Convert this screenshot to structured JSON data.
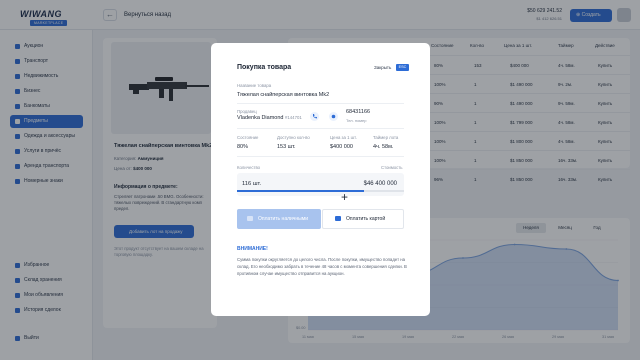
{
  "topbar": {
    "logo_text": "WIWANG",
    "logo_sub": "MARKETPLACE",
    "back_label": "Вернуться назад",
    "balance_main": "$50 629 241.52",
    "balance_sub": "$1 412 626.51",
    "create_label": "Создать"
  },
  "sidebar": {
    "items": [
      {
        "label": "Аукцион"
      },
      {
        "label": "Транспорт"
      },
      {
        "label": "Недвижимость"
      },
      {
        "label": "Бизнес"
      },
      {
        "label": "Банкоматы"
      },
      {
        "label": "Предметы"
      },
      {
        "label": "Одежда и аксессуары"
      },
      {
        "label": "Услуги в причёс"
      },
      {
        "label": "Аренда транспорта"
      },
      {
        "label": "Номерные знаки"
      }
    ],
    "bottom_items": [
      {
        "label": "Избранное"
      },
      {
        "label": "Склад хранения"
      },
      {
        "label": "Мои объявления"
      },
      {
        "label": "История сделок"
      }
    ],
    "exit_label": "Выйти"
  },
  "product": {
    "title": "Тяжелая снайперская винтовка Mk2",
    "category_label": "Категория:",
    "category_value": "Аммуниция",
    "price_label": "Цена от:",
    "price_value": "$400 000",
    "info_heading": "Информация о предмете:",
    "info_text": "Стреляет патронами .50 BMG. Особенности: тяжелых повреждений. В стандартную комп предел.",
    "fav_label": "Добавить лот на продажу",
    "note": "Этот продукт отсутствует на вашем складе на торговую площадку."
  },
  "table": {
    "headers": [
      "Состояние",
      "Кол-во",
      "Цена за 1 шт.",
      "Таймер",
      "Действие"
    ],
    "rows": [
      {
        "state": "80%",
        "qty": "153",
        "price": "$400 000",
        "timer": "4ч. 58м.",
        "action": "Купить"
      },
      {
        "state": "100%",
        "qty": "1",
        "price": "$1 490 000",
        "timer": "9ч. 2м.",
        "action": "Купить"
      },
      {
        "state": "90%",
        "qty": "1",
        "price": "$1 490 000",
        "timer": "9ч. 59м.",
        "action": "Купить"
      },
      {
        "state": "100%",
        "qty": "1",
        "price": "$1 799 000",
        "timer": "4ч. 58м.",
        "action": "Купить"
      },
      {
        "state": "100%",
        "qty": "1",
        "price": "$1 800 000",
        "timer": "4ч. 58м.",
        "action": "Купить"
      },
      {
        "state": "100%",
        "qty": "1",
        "price": "$1 850 000",
        "timer": "16ч. 33м.",
        "action": "Купить"
      },
      {
        "state": "96%",
        "qty": "1",
        "price": "$1 850 000",
        "timer": "16ч. 33м.",
        "action": "Купить"
      }
    ]
  },
  "chart": {
    "periods": [
      "Неделя",
      "Месяц",
      "Год"
    ],
    "active_period": "Неделя",
    "accent": "#7ba3e0",
    "y_label_bottom": "$0.00",
    "x_ticks": [
      "11 мая",
      "15 мая",
      "19 мая",
      "22 мая",
      "26 мая",
      "29 мая",
      "31 мая"
    ]
  },
  "chart_data": {
    "type": "area",
    "x": [
      "11 мая",
      "15 мая",
      "19 мая",
      "22 мая",
      "26 мая",
      "29 мая",
      "31 мая"
    ],
    "series": [
      {
        "values": [
          0.3,
          0.45,
          0.62,
          0.8,
          0.95,
          0.9,
          0.55
        ]
      }
    ],
    "ylabel": "",
    "grid": true
  },
  "modal": {
    "title": "Покупка товара",
    "close_label": "Закрыть",
    "esc_label": "ESC",
    "item_name_label": "Название товара",
    "item_name": "Тяжелая снайперская винтовка Mk2",
    "seller_label": "Продавец",
    "seller_name": "Vladenka Diamond",
    "seller_id": "#144701",
    "phone_value": "68431166",
    "phone_label": "Тел. номер",
    "stats": [
      {
        "label": "Состояние",
        "value": "80%"
      },
      {
        "label": "Доступно кол-во",
        "value": "153 шт."
      },
      {
        "label": "Цена за 1 шт.",
        "value": "$400 000"
      },
      {
        "label": "Таймер лота",
        "value": "4ч. 58м."
      }
    ],
    "qty_label": "Количество",
    "cost_label": "Стоимость",
    "qty_value": "116 шт.",
    "cost_value": "$46 400 000",
    "slider_fraction": 0.758,
    "pay_cash_label": "Оплатить наличными",
    "pay_card_label": "Оплатить картой",
    "warning_heading": "ВНИМАНИЕ!",
    "warning_text": "Сумма покупки округляется до целого числа. После покупки, имущество попадет на склад. Его необходимо забрать в течение 48 часов с момента совершения сделки. В противном случае имущество отправится на аукцион."
  }
}
